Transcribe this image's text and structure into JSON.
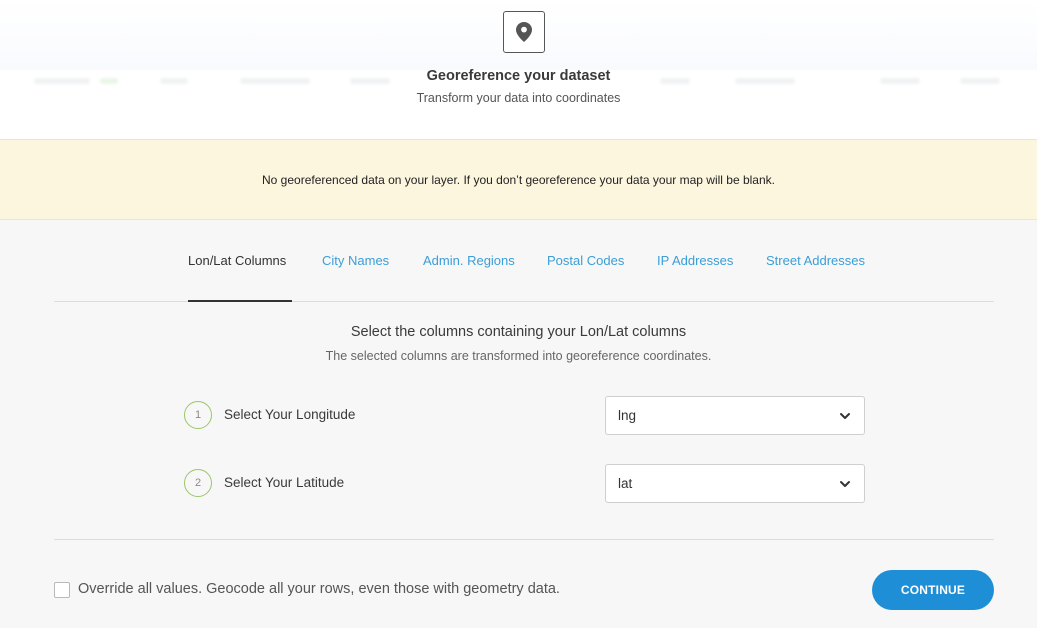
{
  "header": {
    "icon": "map-pin-icon",
    "title": "Georeference your dataset",
    "subtitle": "Transform your data into coordinates"
  },
  "warning": {
    "message": "No georeferenced data on your layer. If you don’t georeference your data your map will be blank."
  },
  "tabs": [
    {
      "label": "Lon/Lat Columns",
      "active": true
    },
    {
      "label": "City Names",
      "active": false
    },
    {
      "label": "Admin. Regions",
      "active": false
    },
    {
      "label": "Postal Codes",
      "active": false
    },
    {
      "label": "IP Addresses",
      "active": false
    },
    {
      "label": "Street Addresses",
      "active": false
    }
  ],
  "section": {
    "title": "Select the columns containing your Lon/Lat columns",
    "subtitle": "The selected columns are transformed into georeference coordinates."
  },
  "steps": [
    {
      "number": "1",
      "label": "Select Your Longitude",
      "selected_value": "lng"
    },
    {
      "number": "2",
      "label": "Select Your Latitude",
      "selected_value": "lat"
    }
  ],
  "footer": {
    "override_checked": false,
    "override_label": "Override all values. Geocode all your rows, even those with geometry data.",
    "continue_label": "CONTINUE"
  },
  "colors": {
    "accent": "#1e8fd6",
    "link": "#3b9ed8",
    "warning_bg": "#fcf6df",
    "step_ring": "#9bc66a"
  }
}
